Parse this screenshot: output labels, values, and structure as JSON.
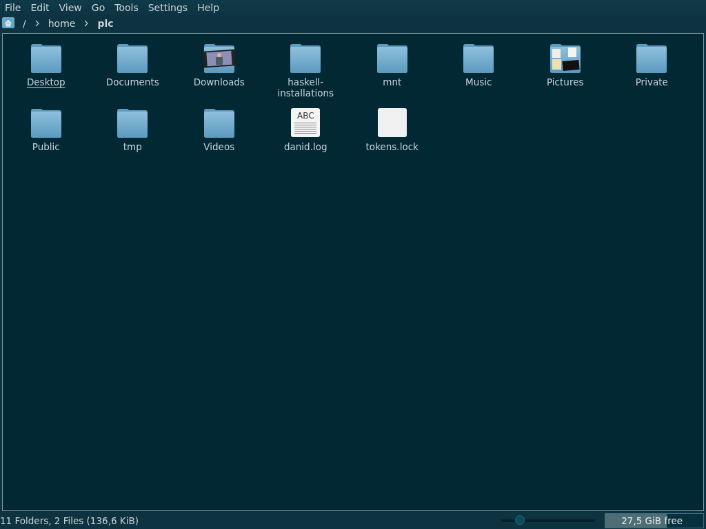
{
  "menu_bar": [
    "File",
    "Edit",
    "View",
    "Go",
    "Tools",
    "Settings",
    "Help"
  ],
  "breadcrumb": [
    {
      "label": "/",
      "current": false
    },
    {
      "label": "home",
      "current": false
    },
    {
      "label": "plc",
      "current": true
    }
  ],
  "files": [
    {
      "name": "Desktop",
      "kind": "folder",
      "focused": true
    },
    {
      "name": "Documents",
      "kind": "folder",
      "focused": false
    },
    {
      "name": "Downloads",
      "kind": "video-folder",
      "focused": false
    },
    {
      "name": "haskell-\ninstallations",
      "kind": "folder",
      "focused": false
    },
    {
      "name": "mnt",
      "kind": "folder",
      "focused": false
    },
    {
      "name": "Music",
      "kind": "folder",
      "focused": false
    },
    {
      "name": "Pictures",
      "kind": "pictures-folder",
      "focused": false
    },
    {
      "name": "Private",
      "kind": "folder",
      "focused": false
    },
    {
      "name": "Public",
      "kind": "folder",
      "focused": false
    },
    {
      "name": "tmp",
      "kind": "folder",
      "focused": false
    },
    {
      "name": "Videos",
      "kind": "folder",
      "focused": false
    },
    {
      "name": "danid.log",
      "kind": "text-file",
      "focused": false,
      "thumb": "ABC"
    },
    {
      "name": "tokens.lock",
      "kind": "blank-file",
      "focused": false
    }
  ],
  "status_bar": {
    "summary": "11 Folders, 2 Files (136,6 KiB)",
    "zoom": {
      "level": 0.2
    },
    "disk": {
      "label": "27,5 GiB free",
      "level": 0.63
    }
  }
}
